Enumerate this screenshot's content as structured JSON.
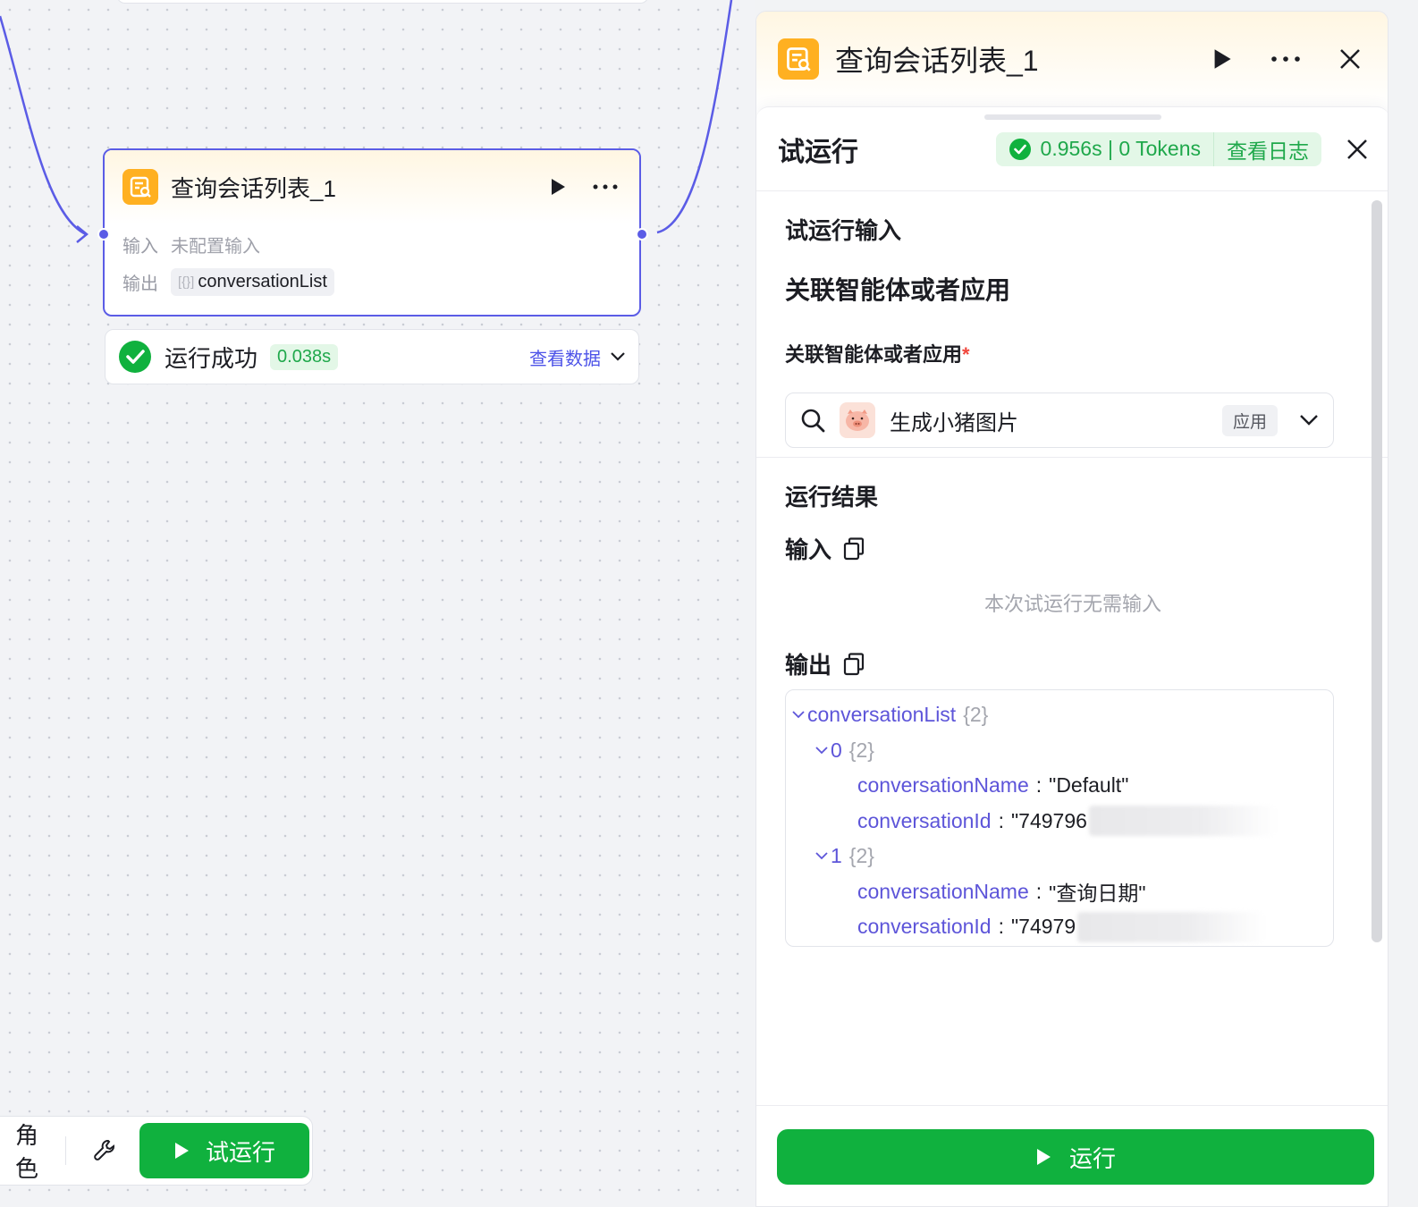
{
  "canvas": {
    "node": {
      "title": "查询会话列表_1",
      "input_label": "输入",
      "input_value": "未配置输入",
      "output_label": "输出",
      "output_brace": "[{}]",
      "output_value": "conversationList"
    },
    "status": {
      "text": "运行成功",
      "time": "0.038s",
      "view_data": "查看数据"
    },
    "toolbar": {
      "role_label": "角色",
      "trial_run": "试运行"
    }
  },
  "panel": {
    "title": "查询会话列表_1",
    "sheet": {
      "title": "试运行",
      "duration_tokens": "0.956s | 0 Tokens",
      "view_log": "查看日志",
      "input_section": {
        "title": "试运行输入",
        "subtitle": "关联智能体或者应用",
        "field_label": "关联智能体或者应用",
        "required_mark": "*",
        "selected_value": "生成小猪图片",
        "tag": "应用"
      },
      "result_section": {
        "title": "运行结果",
        "input_label": "输入",
        "input_empty": "本次试运行无需输入",
        "output_label": "输出",
        "json": {
          "root_key": "conversationList",
          "root_count": "{2}",
          "item0_key": "0",
          "item0_count": "{2}",
          "item0_name_key": "conversationName",
          "item0_name_val": "\"Default\"",
          "item0_id_key": "conversationId",
          "item0_id_val": "\"749796",
          "item1_key": "1",
          "item1_count": "{2}",
          "item1_name_key": "conversationName",
          "item1_name_val": "\"查询日期\"",
          "item1_id_key": "conversationId",
          "item1_id_val": "\"74979",
          "colon": ":"
        }
      },
      "run_button": "运行"
    }
  },
  "colors": {
    "accent": "#5b5ce6",
    "success": "#10b13e",
    "node_icon": "#ffb021"
  }
}
